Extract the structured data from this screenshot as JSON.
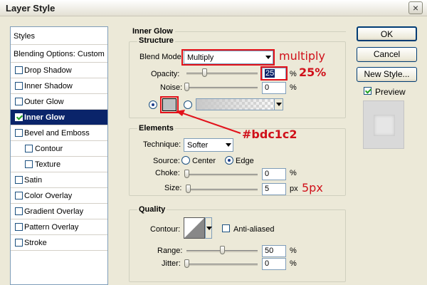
{
  "window": {
    "title": "Layer Style",
    "close_glyph": "×"
  },
  "styles_panel": {
    "header": "Styles",
    "blending": "Blending Options: Custom",
    "items": [
      {
        "label": "Drop Shadow",
        "checked": false
      },
      {
        "label": "Inner Shadow",
        "checked": false
      },
      {
        "label": "Outer Glow",
        "checked": false
      },
      {
        "label": "Inner Glow",
        "checked": true,
        "selected": true
      },
      {
        "label": "Bevel and Emboss",
        "checked": false
      },
      {
        "label": "Contour",
        "checked": false,
        "sub": true
      },
      {
        "label": "Texture",
        "checked": false,
        "sub": true
      },
      {
        "label": "Satin",
        "checked": false
      },
      {
        "label": "Color Overlay",
        "checked": false
      },
      {
        "label": "Gradient Overlay",
        "checked": false
      },
      {
        "label": "Pattern Overlay",
        "checked": false
      },
      {
        "label": "Stroke",
        "checked": false
      }
    ]
  },
  "panel_title": "Inner Glow",
  "structure": {
    "title": "Structure",
    "blend_mode_label": "Blend Mode:",
    "blend_mode_value": "Multiply",
    "opacity_label": "Opacity:",
    "opacity_value": "25",
    "opacity_unit": "%",
    "opacity_level": 25,
    "noise_label": "Noise:",
    "noise_value": "0",
    "noise_unit": "%",
    "noise_level": 0,
    "glow_color": "#bdc1c2"
  },
  "elements": {
    "title": "Elements",
    "technique_label": "Technique:",
    "technique_value": "Softer",
    "source_label": "Source:",
    "source_center": "Center",
    "source_edge": "Edge",
    "choke_label": "Choke:",
    "choke_value": "0",
    "choke_unit": "%",
    "choke_level": 0,
    "size_label": "Size:",
    "size_value": "5",
    "size_unit": "px",
    "size_level": 2
  },
  "quality": {
    "title": "Quality",
    "contour_label": "Contour:",
    "anti_aliased_label": "Anti-aliased",
    "anti_aliased": false,
    "range_label": "Range:",
    "range_value": "50",
    "range_unit": "%",
    "range_level": 50,
    "jitter_label": "Jitter:",
    "jitter_value": "0",
    "jitter_unit": "%",
    "jitter_level": 0
  },
  "buttons": {
    "ok": "OK",
    "cancel": "Cancel",
    "new_style": "New Style...",
    "preview_label": "Preview",
    "preview_checked": true
  },
  "annotations": {
    "multiply": "multiply",
    "opacity": "25%",
    "color": "#bdc1c2",
    "size": "5px",
    "annotation_color": "#d0101a"
  }
}
